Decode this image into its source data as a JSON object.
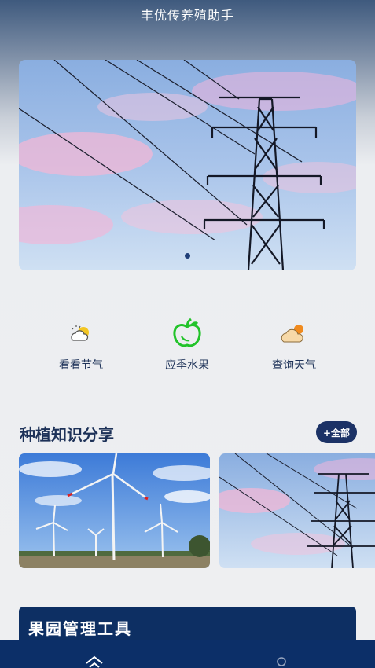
{
  "app": {
    "title": "丰优传养殖助手"
  },
  "banner": {
    "image": "power-tower-sky-photo",
    "indicator_count": 1,
    "active_index": 0
  },
  "shortcuts": [
    {
      "label": "看看节气",
      "icon": "sun-cloud-icon"
    },
    {
      "label": "应季水果",
      "icon": "apple-icon"
    },
    {
      "label": "查询天气",
      "icon": "weather-cloud-icon"
    }
  ],
  "knowledge": {
    "title": "种植知识分享",
    "more_label": "+全部",
    "cards": [
      {
        "image": "wind-turbines-photo"
      },
      {
        "image": "power-tower-sky-photo"
      }
    ]
  },
  "tools": {
    "title": "果园管理工具"
  },
  "nav": {
    "items": [
      {
        "icon": "home-icon"
      },
      {
        "icon": "user-icon"
      }
    ]
  },
  "colors": {
    "primary": "#0d2f63",
    "accent_green": "#22c32a",
    "text_dark": "#1d3158"
  }
}
